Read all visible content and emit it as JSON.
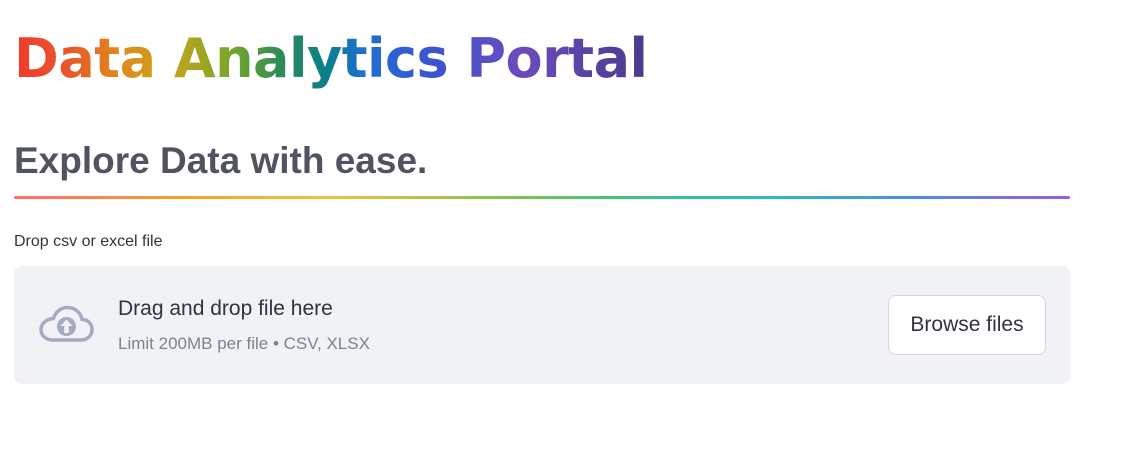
{
  "header": {
    "title": "Data Analytics Portal",
    "subtitle": "Explore Data with ease."
  },
  "uploader": {
    "label": "Drop csv or excel file",
    "icon": "cloud-upload-icon",
    "dropzone_title": "Drag and drop file here",
    "dropzone_subtitle": "Limit 200MB per file • CSV, XLSX",
    "browse_label": "Browse files"
  },
  "colors": {
    "text": "#31333f",
    "subtitle": "#515361",
    "dropzone_bg": "#f0f2f6",
    "muted_text": "#7f8190",
    "icon": "#a3aac2"
  }
}
